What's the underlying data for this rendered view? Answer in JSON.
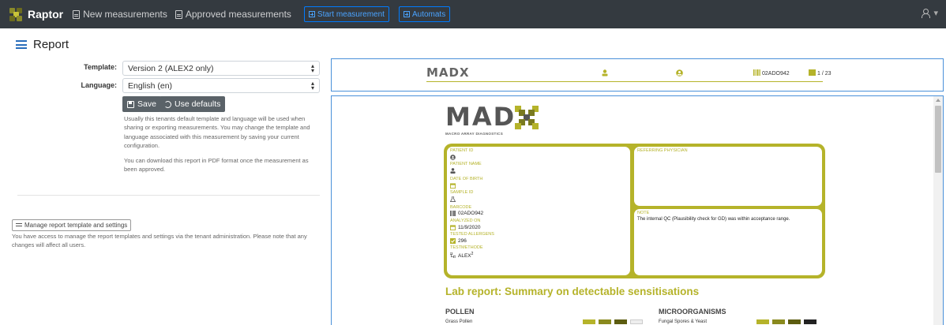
{
  "navbar": {
    "brand": "Raptor",
    "links": [
      {
        "label": "New measurements"
      },
      {
        "label": "Approved measurements"
      }
    ],
    "buttons": [
      {
        "label": "Start measurement"
      },
      {
        "label": "Automats"
      }
    ],
    "user_caret": "▾"
  },
  "page": {
    "title": "Report"
  },
  "form": {
    "template_label": "Template:",
    "template_value": "Version 2 (ALEX2 only)",
    "language_label": "Language:",
    "language_value": "English (en)",
    "save_label": "Save",
    "defaults_label": "Use defaults",
    "help_lines": [
      "Usually this tenants default template and language will be used when",
      "sharing or exporting measurements. You may change the template and",
      "language associated with this measurement by saving your current",
      "configuration."
    ],
    "pdf_lines": [
      "You can download this report in PDF format once the measurement as",
      "been approved."
    ],
    "manage_label": "Manage report template and settings",
    "manage_lines": [
      "You have access to manage the report templates and settings via the tenant administration. Please note that any",
      "changes will affect all users."
    ]
  },
  "preview_header": {
    "logo": "MADX",
    "barcode": "02ADO942",
    "pages": "1 / 23"
  },
  "report": {
    "logo": "MAD",
    "tagline": "MACRO ARRAY DIAGNOSTICS",
    "fields": {
      "patient_id": "PATIENT ID",
      "patient_name": "PATIENT NAME",
      "date_of_birth": "DATE OF BIRTH",
      "sample_id": "SAMPLE ID",
      "barcode_label": "BARCODE",
      "barcode_value": "02ADO942",
      "analyzed_on_label": "ANALYZED ON",
      "analyzed_on_value": "11/9/2020",
      "tested_allergens_label": "TESTED ALLERGENS",
      "tested_allergens_value": "296",
      "testmethode_label": "TESTMETHODE",
      "testmethode_value": "ALEX",
      "testmethode_sup": "2"
    },
    "referring_physician": "REFERRING PHYSICIAN",
    "note_label": "NOTE",
    "note_text": "The internal QC (Plausibility check for GD) was within acceptance range.",
    "lab_title": "Lab report: Summary on detectable sensitisations",
    "sections": [
      {
        "title": "POLLEN",
        "row": "Grass Pollen"
      },
      {
        "title": "MICROORGANISMS",
        "row": "Fungal Spores & Yeast"
      }
    ]
  },
  "colors": {
    "navbar": "#343a40",
    "accent": "#b5b32a",
    "primary": "#007bff"
  }
}
